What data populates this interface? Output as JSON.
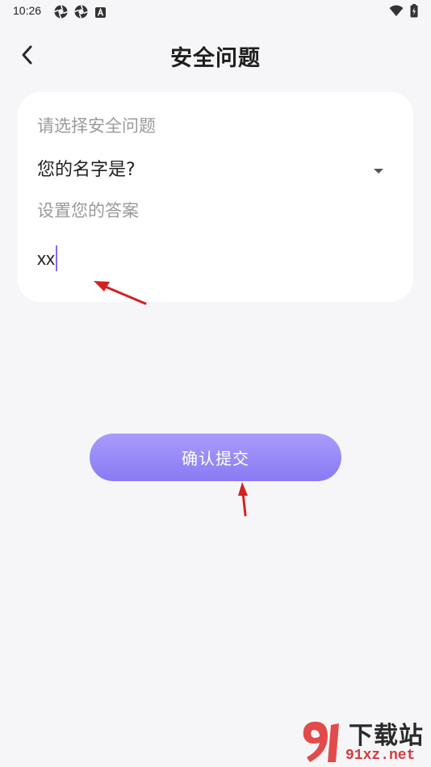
{
  "status_bar": {
    "time": "10:26"
  },
  "nav": {
    "title": "安全问题"
  },
  "form": {
    "question_label": "请选择安全问题",
    "question_value": "您的名字是?",
    "answer_label": "设置您的答案",
    "answer_value": "xx"
  },
  "actions": {
    "submit_label": "确认提交"
  },
  "watermark": {
    "top": "下载站",
    "bottom": "91xz.net"
  },
  "colors": {
    "accent": "#8a7af4",
    "background": "#f6f6f8",
    "annotation_arrow": "#d42020"
  }
}
